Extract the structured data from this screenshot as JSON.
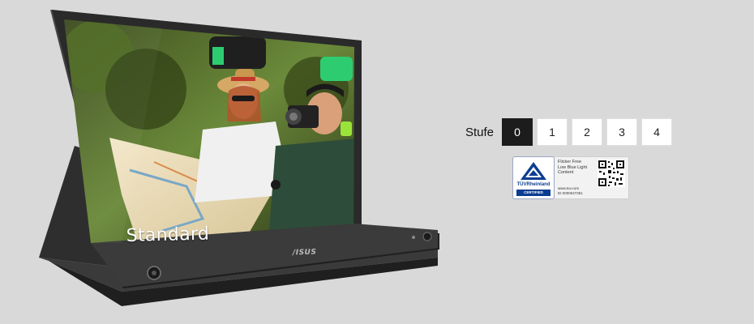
{
  "monitor": {
    "mode_label": "Standard",
    "brand_logo": "/ISUS"
  },
  "level_selector": {
    "label": "Stufe",
    "options": [
      "0",
      "1",
      "2",
      "3",
      "4"
    ],
    "selected": "0"
  },
  "certification": {
    "org_name": "TÜVRheinland",
    "tag": "CERTIFIED",
    "lines": [
      "Flicker Free",
      "Low Blue Light",
      "Content"
    ],
    "url": "www.tuv.com",
    "id_text": "ID 0000047351"
  },
  "colors": {
    "background": "#d9d9d9",
    "active_button": "#1c1c1c",
    "inactive_button": "#ffffff",
    "cert_blue": "#0b3d91"
  }
}
